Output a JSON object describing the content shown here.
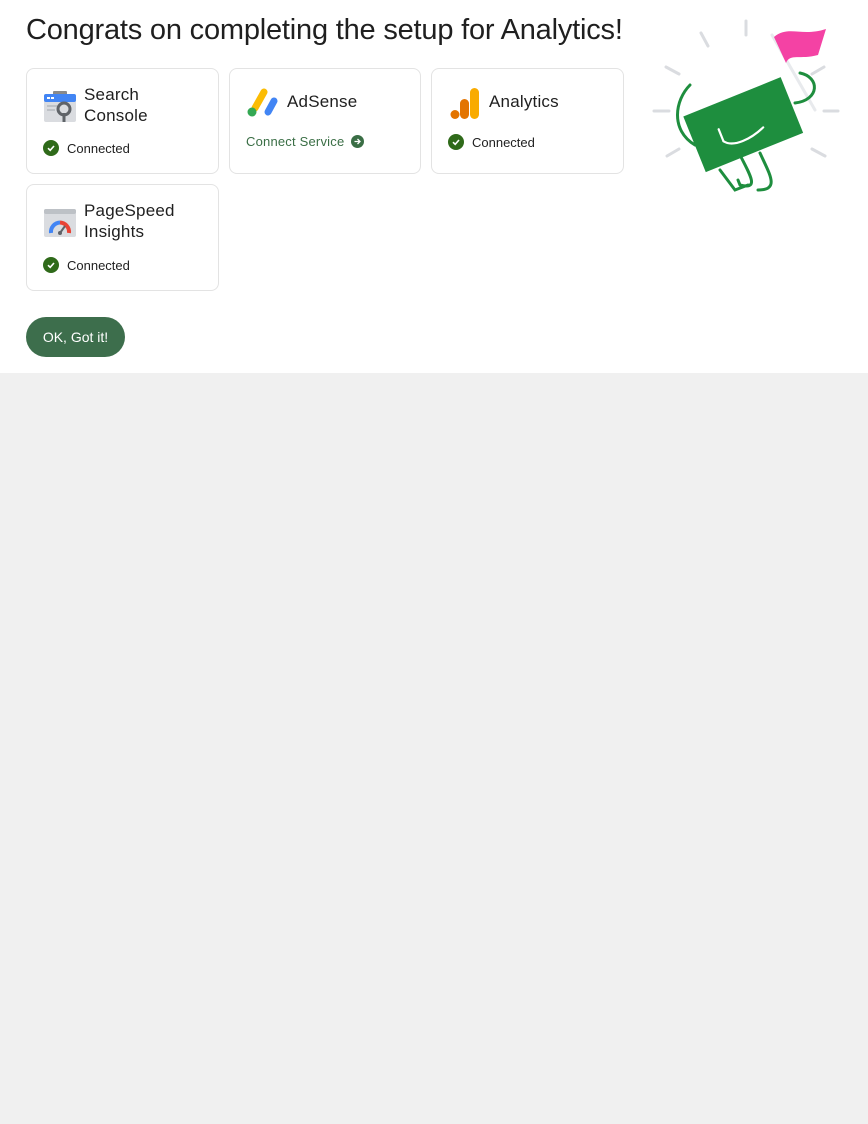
{
  "dialog": {
    "title": "Congrats on completing the setup for Analytics!"
  },
  "services": [
    {
      "name": "Search Console",
      "icon": "search-console-icon",
      "status": "Connected"
    },
    {
      "name": "AdSense",
      "icon": "adsense-icon",
      "action": "Connect Service"
    },
    {
      "name": "Analytics",
      "icon": "analytics-icon",
      "status": "Connected"
    },
    {
      "name": "PageSpeed Insights",
      "icon": "pagespeed-insights-icon",
      "status": "Connected"
    }
  ],
  "button": {
    "label": "OK, Got it!"
  },
  "colors": {
    "primary": "#3d6e4c",
    "check": "#2f6a1a",
    "link": "#3a6e45",
    "illustration_green": "#1e8e3e",
    "flag_pink": "#f442a4",
    "background": "#f0f0f0"
  }
}
